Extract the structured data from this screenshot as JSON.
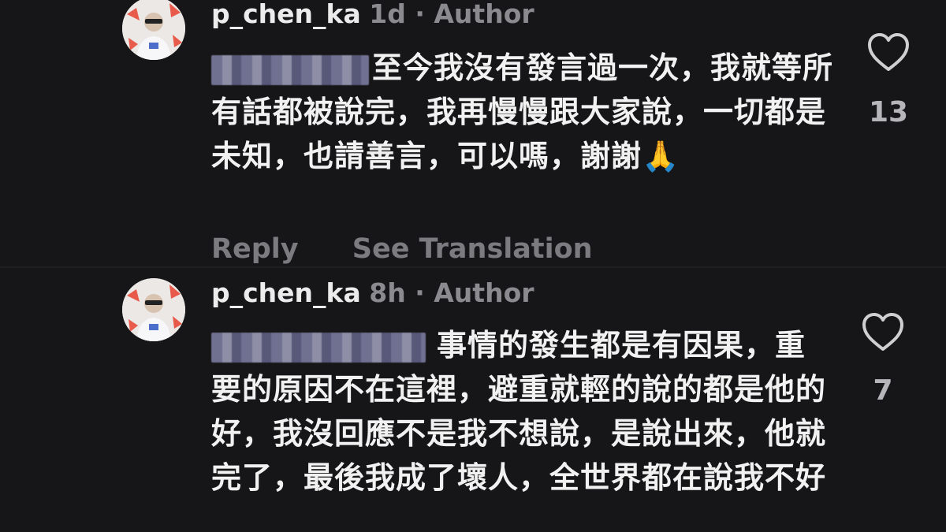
{
  "comments": [
    {
      "username": "p_chen_ka",
      "time": "1d",
      "separator": " · ",
      "role": "Author",
      "text": "至今我沒有發言過一次，我就等所有話都被說完，我再慢慢跟大家說，一切都是未知，也請善言，可以嗎，謝謝🙏",
      "likes": "13",
      "reply_label": "Reply",
      "translate_label": "See Translation"
    },
    {
      "username": "p_chen_ka",
      "time": "8h",
      "separator": " · ",
      "role": "Author",
      "text": "事情的發生都是有因果，重要的原因不在這裡，避重就輕的說的都是他的好，我沒回應不是我不想說，是說出來，他就完了，最後我成了壞人，全世界都在說我不好",
      "likes": "7"
    }
  ],
  "icons": {
    "like": "heart-outline-icon",
    "avatar": "profile-avatar"
  },
  "colors": {
    "background": "#161618",
    "text": "#f1f1f1",
    "meta": "#8b8b8f",
    "action": "#7c7c80"
  }
}
